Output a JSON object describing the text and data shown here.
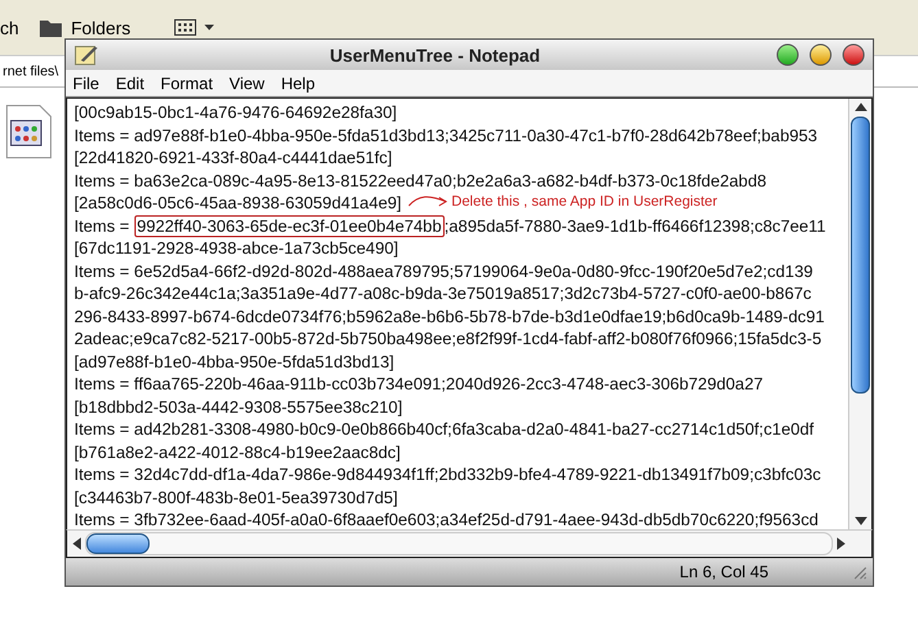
{
  "explorer": {
    "toolbar": [
      {
        "kind": "text",
        "label": "ch"
      },
      {
        "kind": "folders",
        "label": "Folders"
      },
      {
        "kind": "views"
      }
    ],
    "address": "rnet files\\"
  },
  "window": {
    "title": "UserMenuTree - Notepad"
  },
  "menu": [
    "File",
    "Edit",
    "Format",
    "View",
    "Help"
  ],
  "lines": [
    {
      "kind": "plain",
      "text": "[00c9ab15-0bc1-4a76-9476-64692e28fa30]"
    },
    {
      "kind": "plain",
      "text": "Items = ad97e88f-b1e0-4bba-950e-5fda51d3bd13;3425c711-0a30-47c1-b7f0-28d642b78eef;bab953"
    },
    {
      "kind": "plain",
      "text": "[22d41820-6921-433f-80a4-c4441dae51fc]"
    },
    {
      "kind": "plain",
      "text": "Items = ba63e2ca-089c-4a95-8e13-81522eed47a0;b2e2a6a3-a682-b4df-b373-0c18fde2abd8"
    },
    {
      "kind": "plain",
      "text": "[2a58c0d6-05c6-45aa-8938-63059d41a4e9]"
    },
    {
      "kind": "marked",
      "before": "Items = ",
      "marked": "9922ff40-3063-65de-ec3f-01ee0b4e74bb",
      "after": ";a895da5f-7880-3ae9-1d1b-ff6466f12398;c8c7ee11"
    },
    {
      "kind": "plain",
      "text": "[67dc1191-2928-4938-abce-1a73cb5ce490]"
    },
    {
      "kind": "plain",
      "text": "Items = 6e52d5a4-66f2-d92d-802d-488aea789795;57199064-9e0a-0d80-9fcc-190f20e5d7e2;cd139"
    },
    {
      "kind": "plain",
      "text": "b-afc9-26c342e44c1a;3a351a9e-4d77-a08c-b9da-3e75019a8517;3d2c73b4-5727-c0f0-ae00-b867c"
    },
    {
      "kind": "plain",
      "text": "296-8433-8997-b674-6dcde0734f76;b5962a8e-b6b6-5b78-b7de-b3d1e0dfae19;b6d0ca9b-1489-dc91"
    },
    {
      "kind": "plain",
      "text": "2adeac;e9ca7c82-5217-00b5-872d-5b750ba498ee;e8f2f99f-1cd4-fabf-aff2-b080f76f0966;15fa5dc3-5"
    },
    {
      "kind": "plain",
      "text": "[ad97e88f-b1e0-4bba-950e-5fda51d3bd13]"
    },
    {
      "kind": "plain",
      "text": "Items = ff6aa765-220b-46aa-911b-cc03b734e091;2040d926-2cc3-4748-aec3-306b729d0a27"
    },
    {
      "kind": "plain",
      "text": "[b18dbbd2-503a-4442-9308-5575ee38c210]"
    },
    {
      "kind": "plain",
      "text": "Items = ad42b281-3308-4980-b0c9-0e0b866b40cf;6fa3caba-d2a0-4841-ba27-cc2714c1d50f;c1e0df"
    },
    {
      "kind": "plain",
      "text": "[b761a8e2-a422-4012-88c4-b19ee2aac8dc]"
    },
    {
      "kind": "plain",
      "text": "Items = 32d4c7dd-df1a-4da7-986e-9d844934f1ff;2bd332b9-bfe4-4789-9221-db13491f7b09;c3bfc03c"
    },
    {
      "kind": "plain",
      "text": "[c34463b7-800f-483b-8e01-5ea39730d7d5]"
    },
    {
      "kind": "plain",
      "text": "Items = 3fb732ee-6aad-405f-a0a0-6f8aaef0e603;a34ef25d-d791-4aee-943d-db5db70c6220;f9563cd"
    }
  ],
  "annotation": "Delete this , same App ID in UserRegister",
  "status_bar": "Ln 6, Col 45"
}
